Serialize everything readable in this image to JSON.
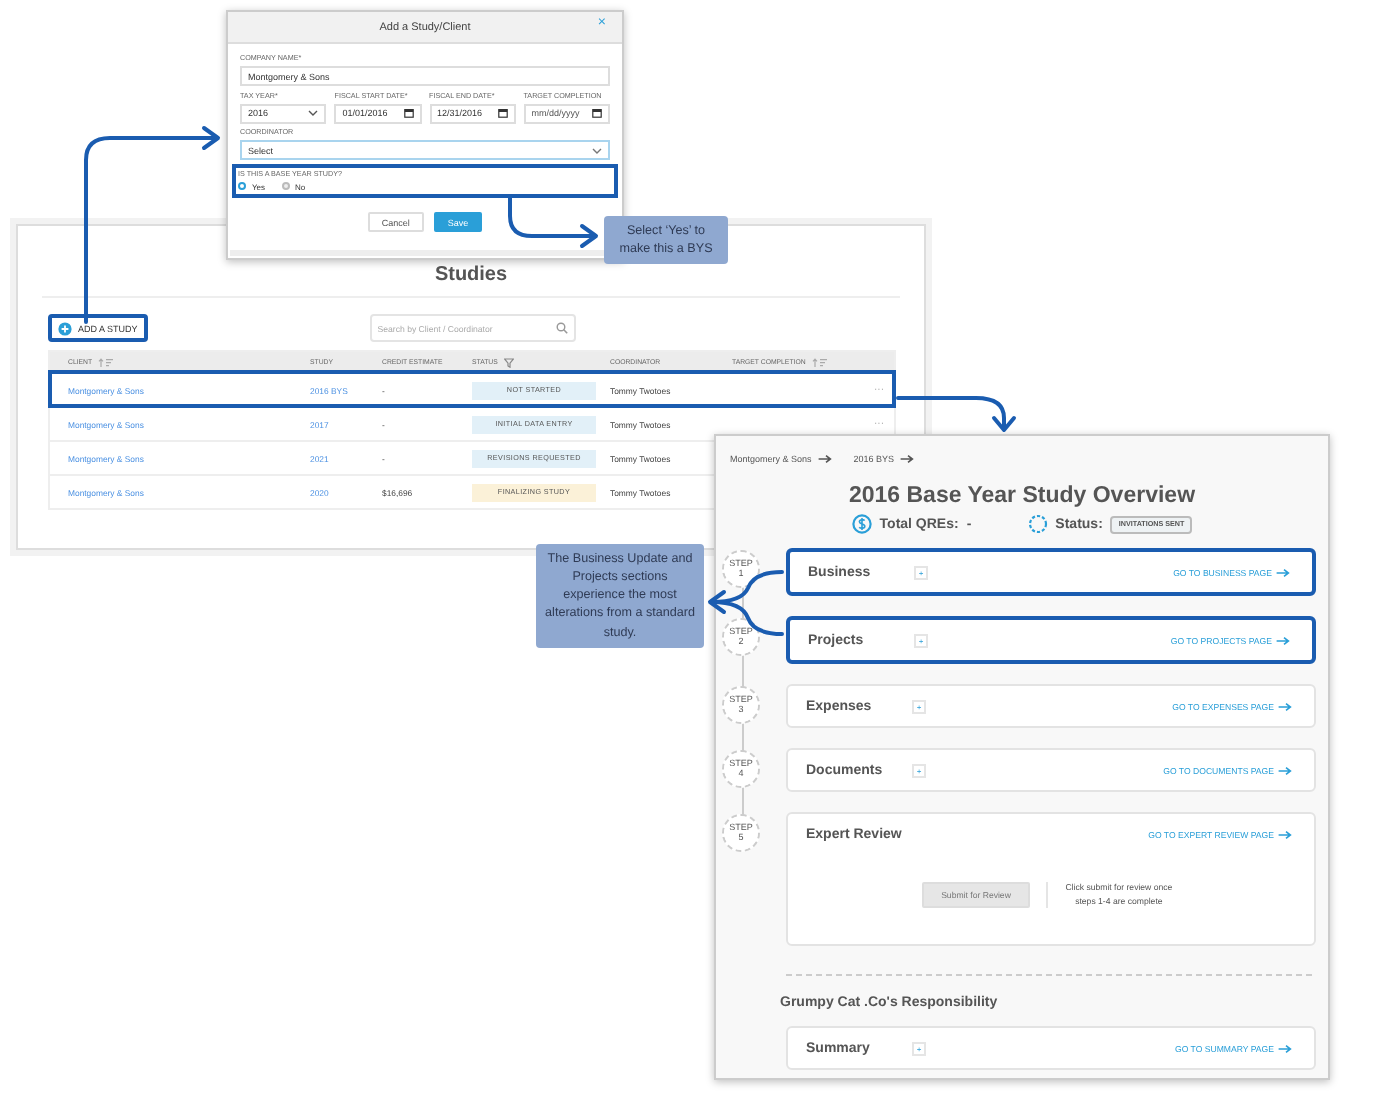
{
  "dialog": {
    "title": "Add a Study/Client",
    "close": "×",
    "company": {
      "label": "COMPANY NAME*",
      "value": "Montgomery & Sons"
    },
    "date_fields": [
      {
        "label": "TAX YEAR*",
        "value": "2016",
        "kind": "select"
      },
      {
        "label": "FISCAL START DATE*",
        "value": "01/01/2016",
        "kind": "date"
      },
      {
        "label": "FISCAL END DATE*",
        "value": "12/31/2016",
        "kind": "date"
      },
      {
        "label": "TARGET COMPLETION",
        "placeholder": "mm/dd/yyyy",
        "kind": "date"
      }
    ],
    "coordinator": {
      "label": "COORDINATOR",
      "value": "Select"
    },
    "base_year": {
      "question": "IS THIS A BASE YEAR STUDY?",
      "highlighted": true,
      "options": [
        {
          "label": "Yes",
          "selected": true
        },
        {
          "label": "No",
          "selected": false
        }
      ]
    },
    "buttons": [
      {
        "label": "Cancel",
        "kind": "secondary"
      },
      {
        "label": "Save",
        "kind": "primary"
      }
    ]
  },
  "studies": {
    "title": "Studies",
    "add_button": {
      "label": "ADD A STUDY",
      "highlighted": true
    },
    "search": {
      "placeholder": "Search by Client / Coordinator"
    },
    "columns": [
      {
        "label": "CLIENT",
        "kind": "sortable"
      },
      {
        "label": "STUDY",
        "kind": "plain"
      },
      {
        "label": "CREDIT ESTIMATE",
        "kind": "plain"
      },
      {
        "label": "STATUS",
        "kind": "filterable"
      },
      {
        "label": "COORDINATOR",
        "kind": "plain"
      },
      {
        "label": "TARGET COMPLETION",
        "kind": "sortable"
      }
    ],
    "rows": [
      {
        "client": "Montgomery & Sons",
        "study": "2016 BYS",
        "credit_estimate": "-",
        "status": {
          "label": "NOT STARTED",
          "color": "#e2f0f8"
        },
        "coordinator": "Tommy Twotoes",
        "menu": "···",
        "highlighted": true
      },
      {
        "client": "Montgomery & Sons",
        "study": "2017",
        "credit_estimate": "-",
        "status": {
          "label": "INITIAL DATA ENTRY",
          "color": "#e2f0f8"
        },
        "coordinator": "Tommy Twotoes",
        "menu": "···",
        "highlighted": false
      },
      {
        "client": "Montgomery & Sons",
        "study": "2021",
        "credit_estimate": "-",
        "status": {
          "label": "REVISIONS REQUESTED",
          "color": "#e2f0f8"
        },
        "coordinator": "Tommy Twotoes",
        "highlighted": false
      },
      {
        "client": "Montgomery & Sons",
        "study": "2020",
        "credit_estimate": "$16,696",
        "status": {
          "label": "FINALIZING STUDY",
          "color": "#fbf1d8"
        },
        "coordinator": "Tommy Twotoes",
        "highlighted": false
      }
    ]
  },
  "overview": {
    "breadcrumbs": [
      "Montgomery & Sons",
      "2016 BYS"
    ],
    "title": "2016 Base Year Study Overview",
    "total_qres": {
      "label": "Total QREs:",
      "value": "-"
    },
    "status": {
      "label": "Status:",
      "value": "INVITATIONS SENT"
    },
    "sections": [
      {
        "kind": "link",
        "step_label": "STEP",
        "step_number": "1",
        "name": "Business",
        "toggle": "+",
        "link": "GO TO BUSINESS PAGE",
        "highlighted": true
      },
      {
        "kind": "link",
        "step_label": "STEP",
        "step_number": "2",
        "name": "Projects",
        "toggle": "+",
        "link": "GO TO PROJECTS PAGE",
        "highlighted": true
      },
      {
        "kind": "link",
        "step_label": "STEP",
        "step_number": "3",
        "name": "Expenses",
        "toggle": "+",
        "link": "GO TO EXPENSES PAGE",
        "highlighted": false
      },
      {
        "kind": "link",
        "step_label": "STEP",
        "step_number": "4",
        "name": "Documents",
        "toggle": "+",
        "link": "GO TO DOCUMENTS PAGE",
        "highlighted": false
      },
      {
        "kind": "review",
        "step_label": "STEP",
        "step_number": "5",
        "name": "Expert Review",
        "link": "GO TO EXPERT REVIEW PAGE",
        "highlighted": false,
        "submit": {
          "label": "Submit for Review",
          "disabled": true
        },
        "note": "Click submit for review once steps 1-4 are complete"
      }
    ],
    "responsibility": {
      "heading": "Grumpy Cat .Co's Responsibility",
      "sections": [
        {
          "kind": "link",
          "name": "Summary",
          "toggle": "+",
          "link": "GO TO SUMMARY PAGE",
          "highlighted": false
        }
      ]
    }
  },
  "notes": [
    {
      "text": "Select ‘Yes’ to make this a BYS"
    },
    {
      "text": "The Business Update and Projects sections experience the most alterations from a standard study."
    }
  ]
}
